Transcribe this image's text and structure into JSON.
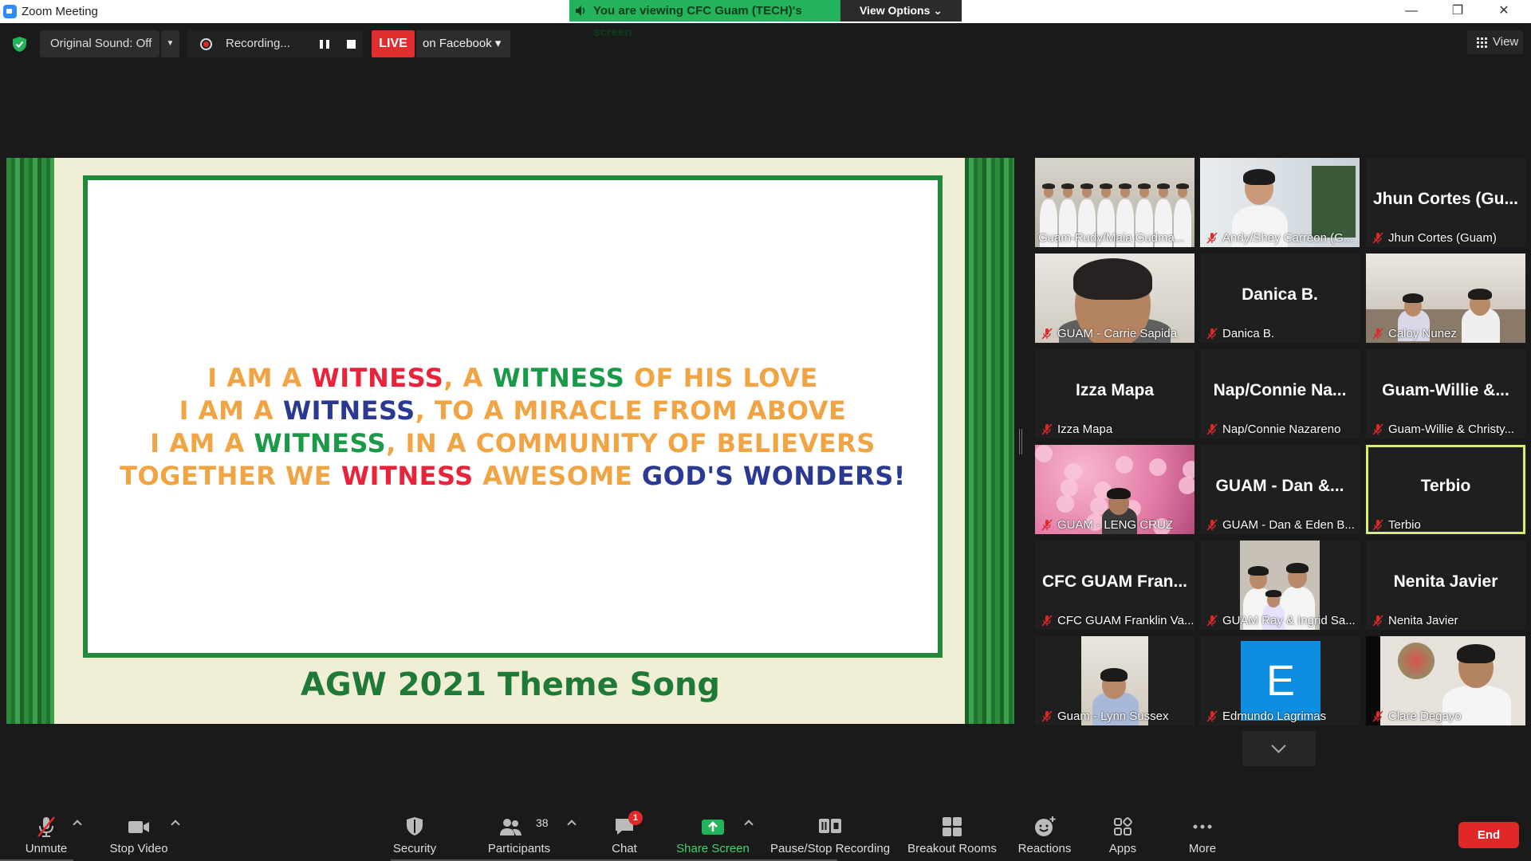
{
  "window": {
    "title": "Zoom Meeting",
    "minimize": "—",
    "restore": "❐",
    "close": "✕"
  },
  "share_banner": {
    "text": "You are viewing CFC Guam (TECH)'s screen",
    "view_options": "View Options ⌄"
  },
  "top_toolbar": {
    "original_sound": "Original Sound: Off",
    "dropdown_arrow": "▼",
    "recording": "Recording...",
    "live_badge": "LIVE",
    "live_target": "on Facebook ▾",
    "view": "View"
  },
  "slide": {
    "lyrics": [
      [
        {
          "t": "I AM A ",
          "c": "o"
        },
        {
          "t": "WITNESS",
          "c": "r"
        },
        {
          "t": ", A ",
          "c": "o"
        },
        {
          "t": "WITNESS",
          "c": "g"
        },
        {
          "t": " OF HIS LOVE",
          "c": "o"
        }
      ],
      [
        {
          "t": "I AM A ",
          "c": "o"
        },
        {
          "t": "WITNESS",
          "c": "b"
        },
        {
          "t": ", TO A MIRACLE FROM ABOVE",
          "c": "o"
        }
      ],
      [
        {
          "t": "I AM A ",
          "c": "o"
        },
        {
          "t": "WITNESS",
          "c": "g"
        },
        {
          "t": ", IN A COMMUNITY OF BELIEVERS",
          "c": "o"
        }
      ],
      [
        {
          "t": "TOGETHER WE ",
          "c": "o"
        },
        {
          "t": "WITNESS",
          "c": "r"
        },
        {
          "t": " AWESOME ",
          "c": "o"
        },
        {
          "t": "GOD'S WONDERS!",
          "c": "b"
        }
      ]
    ],
    "title": "AGW 2021 Theme Song"
  },
  "participants": [
    {
      "label": "Guam-Rudy/Maia Gudma...",
      "video": "photo-group",
      "muted": false
    },
    {
      "label": "Andy/Shey Carreon (G...",
      "video": "photo-woman-home",
      "muted": true
    },
    {
      "label": "Jhun Cortes (Guam)",
      "big": "Jhun Cortes (Gu...",
      "muted": true
    },
    {
      "label": "GUAM - Carrie Sapida",
      "video": "photo-closeup",
      "muted": true
    },
    {
      "label": "Danica B.",
      "big": "Danica B.",
      "muted": true
    },
    {
      "label": "Caloy Nunez",
      "video": "photo-couple-room",
      "muted": true
    },
    {
      "label": "Izza Mapa",
      "big": "Izza Mapa",
      "muted": true
    },
    {
      "label": "Nap/Connie Nazareno",
      "big": "Nap/Connie Na...",
      "muted": true
    },
    {
      "label": "Guam-Willie & Christy...",
      "big": "Guam-Willie &...",
      "muted": true
    },
    {
      "label": "GUAM - LENG CRUZ",
      "video": "photo-blossoms",
      "muted": true
    },
    {
      "label": "GUAM - Dan & Eden B...",
      "big": "GUAM - Dan &...",
      "muted": true
    },
    {
      "label": "Terbio",
      "big": "Terbio",
      "muted": true,
      "active": true
    },
    {
      "label": "CFC GUAM Franklin Va...",
      "big": "CFC GUAM Fran...",
      "muted": true
    },
    {
      "label": "GUAM Ray & Ingrid Sa...",
      "video": "photo-family",
      "muted": true
    },
    {
      "label": "Nenita Javier",
      "big": "Nenita Javier",
      "muted": true
    },
    {
      "label": "Guam - Lynn Sussex",
      "video": "photo-woman-phone",
      "muted": true
    },
    {
      "label": "Edmundo Lagrimas",
      "avatar": "E",
      "muted": true
    },
    {
      "label": "Clare Degayo",
      "video": "photo-woman-flowers",
      "muted": true
    }
  ],
  "bottom_toolbar": {
    "unmute": "Unmute",
    "stop_video": "Stop Video",
    "security": "Security",
    "participants": "Participants",
    "participants_count": "38",
    "chat": "Chat",
    "chat_badge": "1",
    "share_screen": "Share Screen",
    "pause_stop_recording": "Pause/Stop Recording",
    "breakout_rooms": "Breakout Rooms",
    "reactions": "Reactions",
    "apps": "Apps",
    "more": "More",
    "end": "End"
  },
  "colors": {
    "share_green": "#23b35a",
    "live_red": "#e02d2d",
    "active_speaker": "#d6f06a",
    "slide_green": "#1e8a3a"
  }
}
